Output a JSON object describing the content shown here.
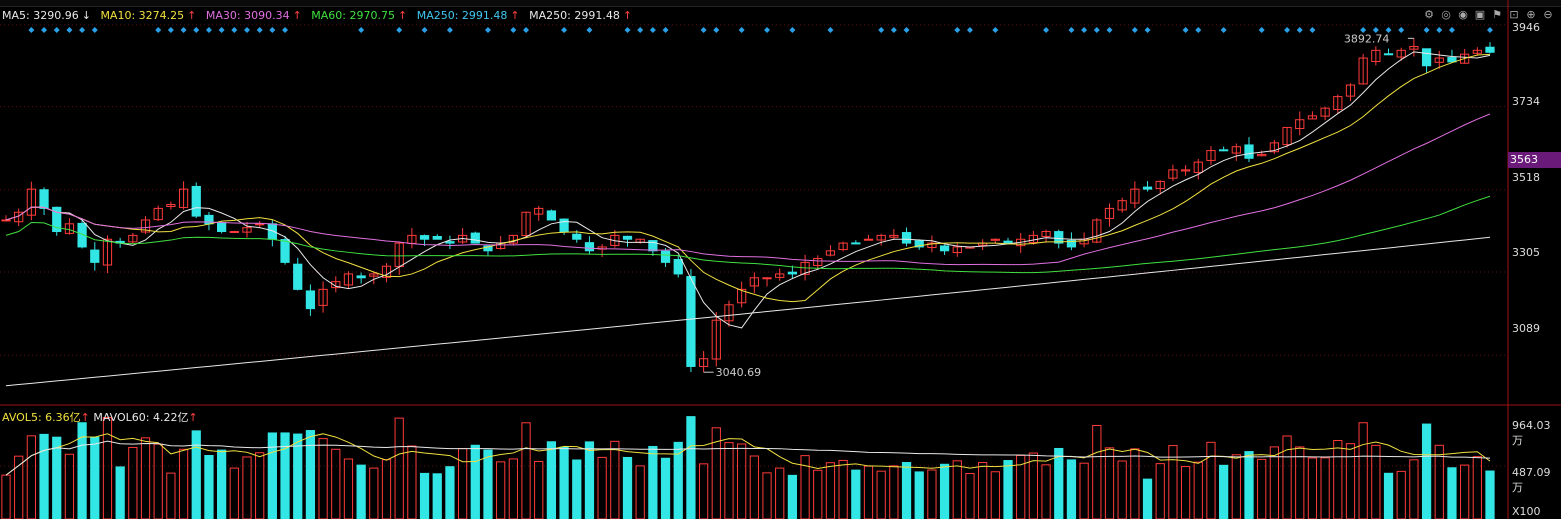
{
  "legend": {
    "ma5": {
      "label": "MA5: 3290.96",
      "arrow": "↓",
      "color": "#e8e8e8"
    },
    "ma10": {
      "label": "MA10: 3274.25",
      "arrow": "↑",
      "color": "#f0e040"
    },
    "ma30": {
      "label": "MA30: 3090.34",
      "arrow": "↑",
      "color": "#e070e0"
    },
    "ma60": {
      "label": "MA60: 2970.75",
      "arrow": "↑",
      "color": "#40e040"
    },
    "ma250a": {
      "label": "MA250: 2991.48",
      "arrow": "↑",
      "color": "#40c8f0"
    },
    "ma250b": {
      "label": "MA250: 2991.48",
      "arrow": "↑",
      "color": "#e8e8e8"
    }
  },
  "vol_legend": {
    "avol5": {
      "label": "AVOL5: 6.36亿",
      "arrow": "↑",
      "color": "#f0e040"
    },
    "mavol60": {
      "label": "MAVOL60: 4.22亿",
      "arrow": "↑",
      "color": "#e8e8e8"
    }
  },
  "toolbar_icons": [
    "gear-icon",
    "eye-slash-icon",
    "eye-icon",
    "layers-icon",
    "flag-icon",
    "lock-icon",
    "zoom-in-icon",
    "zoom-out-icon"
  ],
  "axis": {
    "price_ticks": [
      "3946",
      "3734",
      "3518",
      "3305",
      "3089"
    ],
    "current_price": "3563",
    "vol_ticks": [
      "964.03万",
      "487.09万"
    ],
    "vol_unit": "X100"
  },
  "annotations": {
    "high": "3892.74",
    "low": "3040.69"
  },
  "colors": {
    "up": "#ff3b3b",
    "down": "#33e6e6",
    "ma5": "#e8e8e8",
    "ma10": "#f0e040",
    "ma30": "#e070e0",
    "ma60": "#40e040",
    "ma250": "#e8e8e8",
    "diamond": "#2aa0e8"
  },
  "chart_data": {
    "type": "candlestick",
    "y_axis_ticks": [
      3946,
      3734,
      3518,
      3305,
      3089
    ],
    "ylim": [
      2960,
      3995
    ],
    "current_price": 3563,
    "high_marker": 3892.74,
    "low_marker": 3040.69,
    "ma_latest": {
      "MA5": 3290.96,
      "MA10": 3274.25,
      "MA30": 3090.34,
      "MA60": 2970.75,
      "MA250": 2991.48
    },
    "close_path": [
      3440,
      3460,
      3520,
      3470,
      3410,
      3430,
      3370,
      3330,
      3390,
      3380,
      3400,
      3440,
      3470,
      3480,
      3520,
      3450,
      3430,
      3410,
      3410,
      3420,
      3430,
      3390,
      3330,
      3260,
      3210,
      3260,
      3280,
      3300,
      3290,
      3300,
      3320,
      3380,
      3400,
      3390,
      3390,
      3380,
      3400,
      3380,
      3360,
      3380,
      3400,
      3460,
      3470,
      3440,
      3410,
      3390,
      3360,
      3370,
      3400,
      3390,
      3390,
      3360,
      3330,
      3300,
      3060,
      3080,
      3180,
      3220,
      3260,
      3290,
      3290,
      3300,
      3300,
      3330,
      3340,
      3360,
      3380,
      3380,
      3390,
      3400,
      3400,
      3380,
      3370,
      3380,
      3360,
      3370,
      3370,
      3380,
      3390,
      3380,
      3390,
      3400,
      3410,
      3380,
      3370,
      3390,
      3440,
      3470,
      3490,
      3520,
      3520,
      3540,
      3570,
      3570,
      3590,
      3620,
      3620,
      3630,
      3600,
      3610,
      3640,
      3680,
      3700,
      3710,
      3730,
      3760,
      3790,
      3860,
      3880,
      3870,
      3880,
      3890,
      3840,
      3860,
      3850,
      3870,
      3880,
      3875
    ],
    "volume_ticks": [
      "964.03万",
      "487.09万"
    ],
    "volume_unit": "X100",
    "volume_avg": {
      "AVOL5": "6.36亿",
      "MAVOL60": "4.22亿"
    }
  }
}
